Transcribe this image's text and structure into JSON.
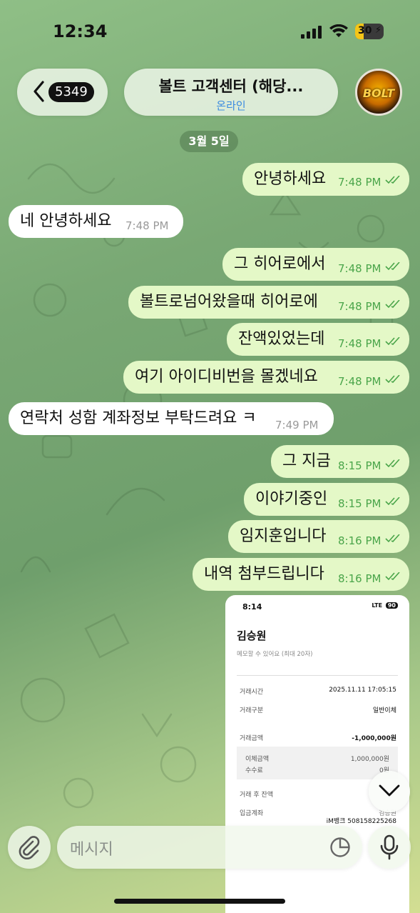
{
  "status_bar": {
    "time": "12:34",
    "battery": "30",
    "battery_level": 0.3,
    "icons": [
      "cellular-signal-icon",
      "wifi-icon",
      "battery-charging-icon"
    ]
  },
  "header": {
    "back_count": "5349",
    "chat_name": "볼트 고객센터 (해당...",
    "chat_status": "온라인",
    "avatar_text": "BOLT"
  },
  "date_chip": "3월 5일",
  "messages": [
    {
      "text": "안녕하세요",
      "time": "7:48 PM",
      "direction": "out",
      "read": true
    },
    {
      "text": "네 안녕하세요",
      "time": "7:48 PM",
      "direction": "in"
    },
    {
      "text": "그 히어로에서",
      "time": "7:48 PM",
      "direction": "out",
      "read": true
    },
    {
      "text": "볼트로넘어왔을때 히어로에",
      "time": "7:48 PM",
      "direction": "out",
      "read": true
    },
    {
      "text": "잔액있었는데",
      "time": "7:48 PM",
      "direction": "out",
      "read": true
    },
    {
      "text": "여기 아이디비번을 몰겠네요",
      "time": "7:48 PM",
      "direction": "out",
      "read": true
    },
    {
      "text": "연락처 성함 계좌정보 부탁드려요 ㅋ",
      "time": "7:49 PM",
      "direction": "in"
    },
    {
      "text": "그 지금",
      "time": "8:15 PM",
      "direction": "out",
      "read": true
    },
    {
      "text": "이야기중인",
      "time": "8:15 PM",
      "direction": "out",
      "read": true
    },
    {
      "text": "임지훈입니다",
      "time": "8:16 PM",
      "direction": "out",
      "read": true
    },
    {
      "text": "내역 첨부드립니다",
      "time": "8:16 PM",
      "direction": "out",
      "read": true
    }
  ],
  "attachment": {
    "time": "8:14",
    "network": "LTE",
    "battery": "90",
    "name": "김승원",
    "memo_hint": "메모할 수 있어요 (최대 20자)",
    "rows": [
      {
        "label": "거래시간",
        "value": "2025.11.11 17:05:15"
      },
      {
        "label": "거래구분",
        "value": "일반이체"
      },
      {
        "label": "거래금액",
        "value": "-1,000,000원"
      },
      {
        "label": "이체금액",
        "value": "1,000,000원"
      },
      {
        "label": "수수료",
        "value": "0원"
      },
      {
        "label": "거래 후 잔액",
        "value": ""
      },
      {
        "label": "입금계좌",
        "value": "김승원"
      },
      {
        "label": "",
        "value": "iM뱅크 508158225268"
      }
    ]
  },
  "composer": {
    "placeholder": "메시지"
  },
  "colors": {
    "outgoing_bubble": "#e4f8c7",
    "incoming_bubble": "#ffffff",
    "outgoing_meta": "#4aa54a",
    "online_status": "#3b8be0"
  }
}
